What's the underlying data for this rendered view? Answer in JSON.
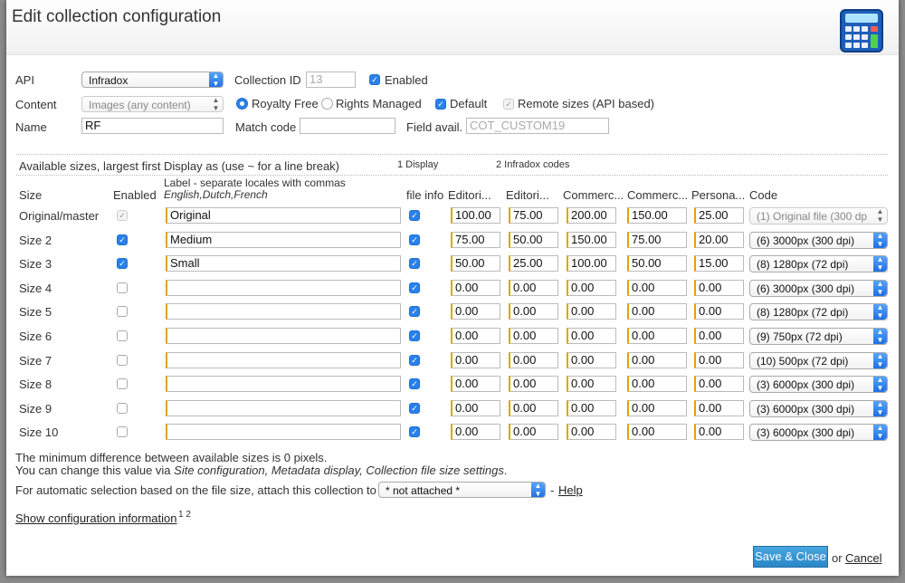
{
  "dialog": {
    "title": "Edit collection configuration"
  },
  "colors": {
    "accent": "#2a81e8",
    "button": "#2a87c8"
  },
  "form": {
    "api_label": "API",
    "api_value": "Infradox",
    "collection_id_label": "Collection ID",
    "collection_id_value": "13",
    "enabled_label": "Enabled",
    "content_label": "Content",
    "content_value": "Images (any content)",
    "royalty_free_label": "Royalty Free",
    "rights_managed_label": "Rights Managed",
    "default_label": "Default",
    "remote_sizes_label": "Remote sizes (API based)",
    "name_label": "Name",
    "name_value": "RF",
    "match_code_label": "Match code",
    "match_code_value": "",
    "field_avail_label": "Field avail.",
    "field_avail_value": "COT_CUSTOM19"
  },
  "sizes": {
    "intro": "Available sizes, largest first",
    "display_as": "Display as (use ~ for a line break)",
    "display_note": "1 Display",
    "codes_note": "2 Infradox codes",
    "label_hint": "Label - separate locales with commas",
    "label_hint_example": "English,Dutch,French",
    "columns": [
      "Size",
      "Enabled",
      "file info",
      "Editori...",
      "Editori...",
      "Commerc...",
      "Commerc...",
      "Persona...",
      "Code"
    ],
    "rows": [
      {
        "size": "Original/master",
        "enabled": "disabled",
        "label": "Original",
        "v1": "100.00",
        "v2": "75.00",
        "v3": "200.00",
        "v4": "150.00",
        "v5": "25.00",
        "code": "(1) Original file (300 dp"
      },
      {
        "size": "Size 2",
        "enabled": "on",
        "label": "Medium",
        "v1": "75.00",
        "v2": "50.00",
        "v3": "150.00",
        "v4": "75.00",
        "v5": "20.00",
        "code": "(6) 3000px (300 dpi)"
      },
      {
        "size": "Size 3",
        "enabled": "on",
        "label": "Small",
        "v1": "50.00",
        "v2": "25.00",
        "v3": "100.00",
        "v4": "50.00",
        "v5": "15.00",
        "code": "(8) 1280px (72 dpi)"
      },
      {
        "size": "Size 4",
        "enabled": "off",
        "label": "",
        "v1": "0.00",
        "v2": "0.00",
        "v3": "0.00",
        "v4": "0.00",
        "v5": "0.00",
        "code": "(6) 3000px (300 dpi)"
      },
      {
        "size": "Size 5",
        "enabled": "off",
        "label": "",
        "v1": "0.00",
        "v2": "0.00",
        "v3": "0.00",
        "v4": "0.00",
        "v5": "0.00",
        "code": "(8) 1280px (72 dpi)"
      },
      {
        "size": "Size 6",
        "enabled": "off",
        "label": "",
        "v1": "0.00",
        "v2": "0.00",
        "v3": "0.00",
        "v4": "0.00",
        "v5": "0.00",
        "code": "(9) 750px (72 dpi)"
      },
      {
        "size": "Size 7",
        "enabled": "off",
        "label": "",
        "v1": "0.00",
        "v2": "0.00",
        "v3": "0.00",
        "v4": "0.00",
        "v5": "0.00",
        "code": "(10) 500px (72 dpi)"
      },
      {
        "size": "Size 8",
        "enabled": "off",
        "label": "",
        "v1": "0.00",
        "v2": "0.00",
        "v3": "0.00",
        "v4": "0.00",
        "v5": "0.00",
        "code": "(3) 6000px (300 dpi)"
      },
      {
        "size": "Size 9",
        "enabled": "off",
        "label": "",
        "v1": "0.00",
        "v2": "0.00",
        "v3": "0.00",
        "v4": "0.00",
        "v5": "0.00",
        "code": "(3) 6000px (300 dpi)"
      },
      {
        "size": "Size 10",
        "enabled": "off",
        "label": "",
        "v1": "0.00",
        "v2": "0.00",
        "v3": "0.00",
        "v4": "0.00",
        "v5": "0.00",
        "code": "(3) 6000px (300 dpi)"
      }
    ]
  },
  "footer": {
    "min_diff": "The minimum difference between available sizes is 0 pixels.",
    "change_prefix": "You can change this value via ",
    "change_path": "Site configuration, Metadata display, Collection file size settings",
    "change_suffix": ".",
    "auto_select": "For automatic selection based on the file size, attach this collection to",
    "attach_value": "* not attached *",
    "dash": "-",
    "help": "Help",
    "show_info": "Show configuration information",
    "show_info_sup": "1 2",
    "save_close": "Save & Close",
    "or": "or",
    "cancel": "Cancel"
  }
}
